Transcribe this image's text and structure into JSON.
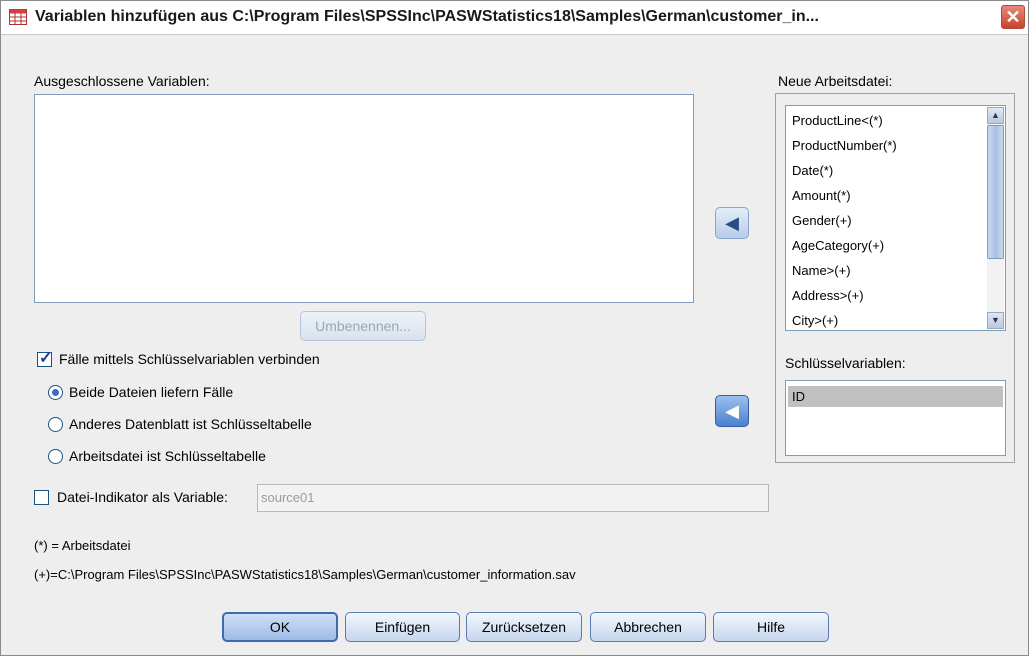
{
  "window": {
    "title": "Variablen hinzufügen aus C:\\Program Files\\SPSSInc\\PASWStatistics18\\Samples\\German\\customer_in...",
    "close_symbol": "✕"
  },
  "excluded": {
    "label": "Ausgeschlossene Variablen:",
    "rename_button": "Umbenennen..."
  },
  "working_file": {
    "label": "Neue Arbeitsdatei:",
    "items": [
      "ProductLine<(*)",
      "ProductNumber(*)",
      "Date(*)",
      "Amount(*)",
      "Gender(+)",
      "AgeCategory(+)",
      "Name>(+)",
      "Address>(+)",
      "City>(+)"
    ]
  },
  "key_vars": {
    "label": "Schlüsselvariablen:",
    "items": [
      "ID"
    ]
  },
  "match_cases": {
    "label": "Fälle mittels Schlüsselvariablen verbinden",
    "checked": true
  },
  "radios": [
    {
      "label": "Beide Dateien liefern Fälle",
      "selected": true
    },
    {
      "label": "Anderes Datenblatt ist Schlüsseltabelle",
      "selected": false
    },
    {
      "label": "Arbeitsdatei ist Schlüsseltabelle",
      "selected": false
    }
  ],
  "file_indicator": {
    "label": "Datei-Indikator als Variable:",
    "value": "source01",
    "checked": false
  },
  "legend": {
    "working": "(*) = Arbeitsdatei",
    "other": "(+)=C:\\Program Files\\SPSSInc\\PASWStatistics18\\Samples\\German\\customer_information.sav"
  },
  "buttons": {
    "ok": "OK",
    "paste": "Einfügen",
    "reset": "Zurücksetzen",
    "cancel": "Abbrechen",
    "help": "Hilfe"
  },
  "icons": {
    "move_arrow": "◀",
    "scroll_up": "▲",
    "scroll_down": "▼"
  },
  "colors": {
    "accent": "#3b6fc6",
    "close": "#c9412b"
  }
}
